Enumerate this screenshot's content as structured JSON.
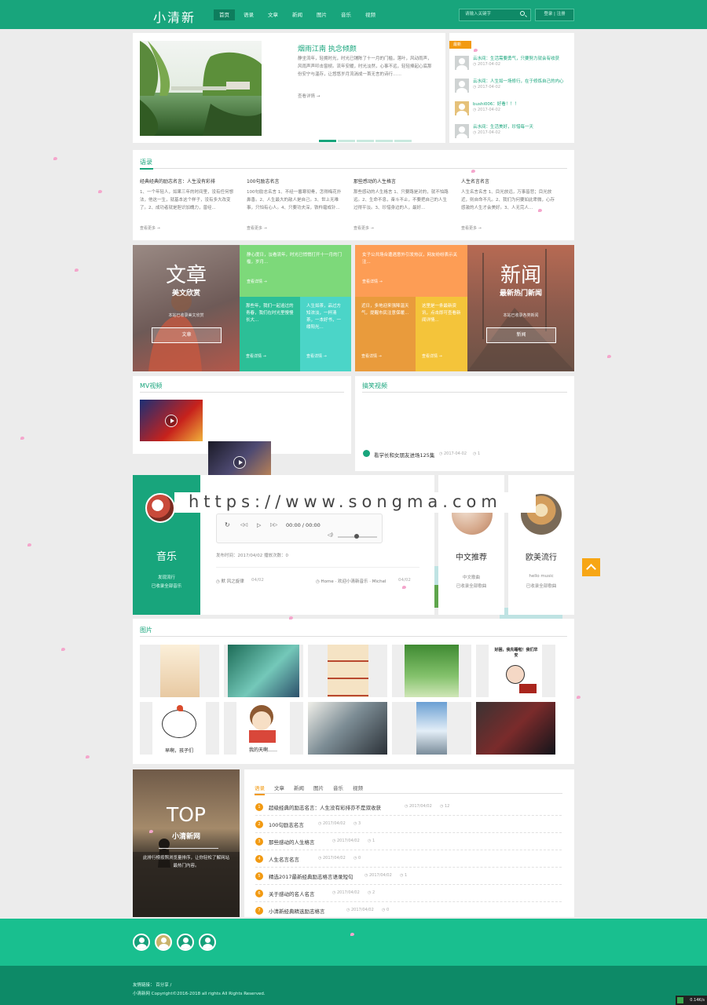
{
  "header": {
    "logo": "小清新",
    "nav": [
      "首页",
      "语录",
      "文章",
      "新闻",
      "图片",
      "音乐",
      "视频"
    ],
    "search_placeholder": "请输入关键字",
    "auth": "登录 | 注册"
  },
  "featured": {
    "title": "烟雨江南 执念倾颜",
    "body": "静坐流年，轻拥时光，时光已铺陈了十一月的门槛，落叶，风动雨声，风雨声声叩击窗棂。流年安暖，时光淡然，心事不远，轻轻捧起心底那份安宁与温存，让悠悠岁月流淌成一首无言的诗行……",
    "more": "查看详情 →"
  },
  "comments": {
    "badge": "最新",
    "items": [
      {
        "text": "云水间：生活需要勇气，只要努力就会有收获",
        "time": "◷ 2017-04-02"
      },
      {
        "text": "云水间：人生如一场修行，在于修炼自己的内心",
        "time": "◷ 2017-04-02"
      },
      {
        "text": "bushi006：好看！！！",
        "time": "◷ 2017-04-02"
      },
      {
        "text": "云水间：生活美好，珍惜每一天",
        "time": "◷ 2017-04-02"
      }
    ]
  },
  "quotes": {
    "heading": "语录",
    "items": [
      {
        "title": "经典经典的励志名言：人生没有彩排",
        "text": "1、一个年轻人，如果三年的时间里，没有任何想法，他这一生，就基本这个样子，没有多大改变了。2、成功者就是胆识加魄力，曾经...",
        "more": "查看更多 →"
      },
      {
        "title": "100句励志名言",
        "text": "100句励志名言 1、不经一番寒彻骨，怎得梅花扑鼻香。2、人生最大的敌人是自己。3、世上无难事，只怕有心人。4、只要功夫深，铁杵磨成针...",
        "more": "查看更多 →"
      },
      {
        "title": "那些感动的人生格言",
        "text": "那些感动的人生格言 1、只要路是对的，就不怕路远。2、生命不息，奋斗不止，不要把自己的人生过得平淡。3、珍惜身边的人，最好...",
        "more": "查看更多 →"
      },
      {
        "title": "人生名言名言",
        "text": "人生名言名言 1、目光放远，万事皆悲；目光放近，则自命不凡。2、我们为何要如此卑微，心存感激的人生才会美好。3、人无完人...",
        "more": "查看更多 →"
      }
    ]
  },
  "articles_tile": {
    "title": "文章",
    "sub": "美文欣赏",
    "desc": "本站已收录美文欣赏",
    "btn": "文章"
  },
  "news_tile": {
    "title": "新闻",
    "sub": "最新热门新闻",
    "desc": "本站已收录各类新闻",
    "btn": "新闻"
  },
  "article_cells": [
    {
      "text": "静心度日，淡看流年，时光已悄悄打开十一月的门槛，岁月...",
      "more": "查看详情 →"
    },
    {
      "text": "那些年，我们一起追过的青春，我们在时光里慢慢长大...",
      "more": "查看详情 →"
    },
    {
      "text": "人生如茶，品过方知浓淡，一杯清茶，一本好书，一缕阳光...",
      "more": "查看详情 →"
    }
  ],
  "news_cells": [
    {
      "text": "女子公共场合遭遇意外引发热议，网友纷纷表示关注...",
      "more": "查看详情 →"
    },
    {
      "text": "近日，多地迎来强降温天气，提醒市民注意保暖...",
      "more": "查看详情 →"
    },
    {
      "text": "这里是一条最新资讯，点击即可查看新闻详情...",
      "more": "查看详情 →"
    }
  ],
  "mv": {
    "heading": "MV视频"
  },
  "funny": {
    "heading": "搞笑视频",
    "caption": "看学长和女朋友进场125集",
    "time": "◷ 2017-04-02",
    "views": "◷ 1"
  },
  "watermark": "https://www.songma.com",
  "music": {
    "title": "音乐",
    "sub1": "发现流行",
    "sub2": "已收录全部音乐",
    "player_time": "00:00 / 00:00",
    "release": "发布时间：2017/04/02  播放次数：0",
    "author": "◷ 默 风之旋律",
    "date1": "04/02",
    "breadcrumb": "◷ Home · 欢迎小清新音乐 · Michel",
    "date2": "04/02",
    "cards": [
      {
        "title": "中文推荐",
        "sub1": "中文歌曲",
        "sub2": "已收录全部歌曲"
      },
      {
        "title": "欧美流行",
        "sub1": "hello music",
        "sub2": "已收录全部歌曲"
      }
    ]
  },
  "gallery": {
    "heading": "图片",
    "captions": [
      "好困，我先睡啦！我们早安",
      "早啊，孩子们",
      "我的天啊……"
    ]
  },
  "top": {
    "title": "TOP",
    "sub": "小清新网",
    "desc": "此排行榜按照浏览量排序，让你轻松了解网站最热门内容。",
    "tabs": [
      "语录",
      "文章",
      "新闻",
      "图片",
      "音乐",
      "视频"
    ],
    "rows": [
      {
        "num": "1",
        "title": "超级经典的励志名言：人生没有彩排亦不是双收获",
        "time": "◷ 2017/04/02",
        "views": "◷ 12"
      },
      {
        "num": "2",
        "title": "100句励志名言",
        "time": "◷ 2017/04/02",
        "views": "◷ 3"
      },
      {
        "num": "3",
        "title": "那些感动的人生格言",
        "time": "◷ 2017/04/02",
        "views": "◷ 1"
      },
      {
        "num": "4",
        "title": "人生名言名言",
        "time": "◷ 2017/04/02",
        "views": "◷ 0"
      },
      {
        "num": "5",
        "title": "精选2017最新经典励志格言语录短句",
        "time": "◷ 2017/04/02",
        "views": "◷ 1"
      },
      {
        "num": "6",
        "title": "关于感动的名人名言",
        "time": "◷ 2017/04/02",
        "views": "◷ 2"
      },
      {
        "num": "7",
        "title": "小清新经典精选励志格言",
        "time": "◷ 2017/04/02",
        "views": "◷ 0"
      }
    ]
  },
  "footer": {
    "links": "友情链接：  百分享  /",
    "copyright": "小清新网 Copyright©2016-2018 all rights All Rights Reserved.",
    "speed": "0.14K/s"
  },
  "colors": {
    "primary": "#18a57c",
    "accent": "#f29a12",
    "footer": "#19bf8f"
  }
}
